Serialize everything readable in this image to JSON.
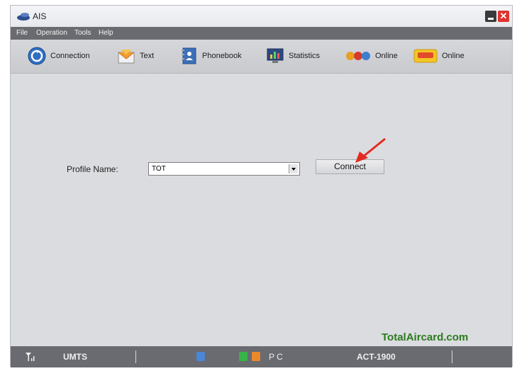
{
  "window": {
    "title": "AIS",
    "minimize_icon": "minimize-icon",
    "close_icon": "close-icon",
    "close_glyph": "✕"
  },
  "menu": {
    "items": [
      {
        "label": "File"
      },
      {
        "label": "Operation"
      },
      {
        "label": "Tools"
      },
      {
        "label": "Help"
      }
    ]
  },
  "toolbar": {
    "items": [
      {
        "label": "Connection",
        "icon": "connection-icon"
      },
      {
        "label": "Text",
        "icon": "envelope-icon"
      },
      {
        "label": "Phonebook",
        "icon": "phonebook-icon"
      },
      {
        "label": "Statistics",
        "icon": "statistics-icon"
      },
      {
        "label": "Online",
        "icon": "online-icon"
      },
      {
        "label": "Online",
        "icon": "online-2-icon"
      }
    ]
  },
  "form": {
    "profile_label": "Profile Name:",
    "profile_value": "TOT",
    "connect_label": "Connect"
  },
  "watermark": "TotalAircard.com",
  "status": {
    "network": "UMTS",
    "mode": "P C",
    "device": "ACT-1900",
    "signal_icon": "signal-icon"
  },
  "colors": {
    "chrome": "#6a6b70",
    "watermark": "#2b7a1f",
    "annotation_arrow": "#e32b20"
  }
}
